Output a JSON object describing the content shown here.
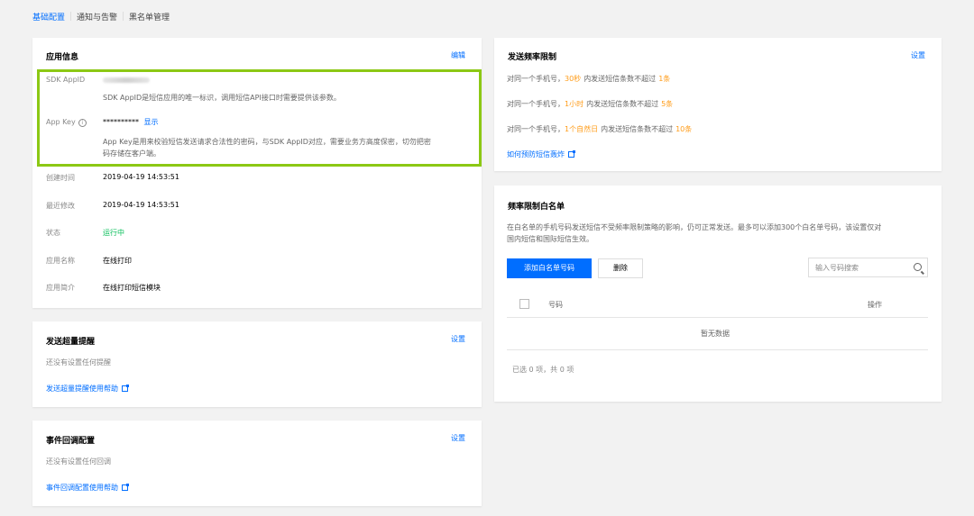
{
  "tabs": [
    "基础配置",
    "通知与告警",
    "黑名单管理"
  ],
  "app_info": {
    "title": "应用信息",
    "edit_label": "编辑",
    "sdk_appid_label": "SDK AppID",
    "sdk_appid_desc": "SDK AppID是短信应用的唯一标识，调用短信API接口时需要提供该参数。",
    "app_key_label": "App Key",
    "app_key_masked": "**********",
    "app_key_show": "显示",
    "app_key_desc_1": "App Key是用来校验短信发送请求合法性的密码，与SDK AppID对应，需要业务方高度保密，切勿把密",
    "app_key_desc_2": "码存储在客户端。",
    "rows": [
      {
        "label": "创建时间",
        "value": "2019-04-19 14:53:51"
      },
      {
        "label": "最近修改",
        "value": "2019-04-19 14:53:51"
      },
      {
        "label": "状态",
        "value": "运行中"
      },
      {
        "label": "应用名称",
        "value": "在线打印"
      },
      {
        "label": "应用简介",
        "value": "在线打印短信模块"
      }
    ]
  },
  "overlimit": {
    "title": "发送超量提醒",
    "action": "设置",
    "desc": "还没有设置任何提醒",
    "help": "发送超量提醒使用帮助"
  },
  "callback": {
    "title": "事件回调配置",
    "action": "设置",
    "desc": "还没有设置任何回调",
    "help": "事件回调配置使用帮助"
  },
  "freq": {
    "title": "发送频率限制",
    "action": "设置",
    "rules": [
      {
        "prefix": "对同一个手机号，",
        "period": "30秒",
        "middle": "内发送短信条数不超过",
        "count": "1条"
      },
      {
        "prefix": "对同一个手机号，",
        "period": "1小时",
        "middle": "内发送短信条数不超过",
        "count": "5条"
      },
      {
        "prefix": "对同一个手机号，",
        "period": "1个自然日",
        "middle": "内发送短信条数不超过",
        "count": "10条"
      }
    ],
    "help": "如何预防短信轰炸"
  },
  "whitelist": {
    "title": "频率限制白名单",
    "desc_1": "在白名单的手机号码发送短信不受频率限制策略的影响，仍可正常发送。最多可以添加300个白名单号码，该设置仅对",
    "desc_2": "国内短信和国际短信生效。",
    "add_button": "添加白名单号码",
    "delete_button": "删除",
    "search_placeholder": "输入号码搜索",
    "col_number": "号码",
    "col_action": "操作",
    "empty": "暂无数据",
    "footer": "已选 0 项，共 0 项"
  },
  "colors": {
    "accent": "#006eff",
    "highlight": "#ff9c19",
    "status": "#0abf5b",
    "frame": "#8cc814"
  }
}
